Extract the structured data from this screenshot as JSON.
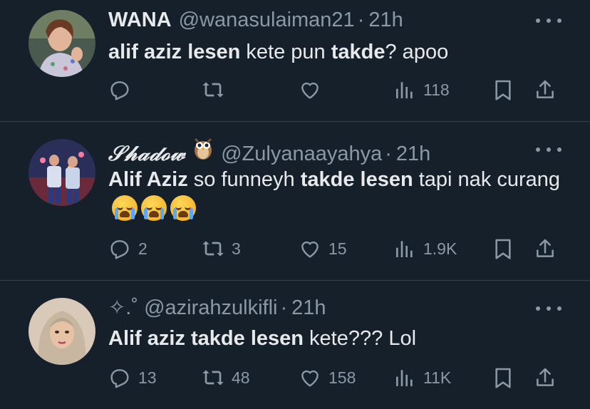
{
  "colors": {
    "background": "#15202b",
    "text_primary": "#e7e9ea",
    "text_secondary": "#8b98a5",
    "divider": "#38444d"
  },
  "tweets": [
    {
      "name": "WANA",
      "handle": "@wanasulaiman21",
      "dot": "·",
      "time": "21h",
      "text_parts": [
        {
          "t": "alif aziz lesen",
          "bold": true
        },
        {
          "t": " kete pun ",
          "bold": false
        },
        {
          "t": "takde",
          "bold": true
        },
        {
          "t": "? apoo",
          "bold": false
        }
      ],
      "replies": "",
      "retweets": "",
      "likes": "",
      "views": "118"
    },
    {
      "name": "𝒮𝒽𝒶𝒹ℴ𝓌",
      "name_emoji": "owl-emoji",
      "handle": "@Zulyanaayahya",
      "dot": "·",
      "time": "21h",
      "text_parts": [
        {
          "t": "Alif Aziz",
          "bold": true
        },
        {
          "t": " so funneyh ",
          "bold": false
        },
        {
          "t": "takde lesen",
          "bold": true
        },
        {
          "t": " tapi nak curang",
          "bold": false
        }
      ],
      "emojis": [
        "loudly-crying-face",
        "loudly-crying-face",
        "loudly-crying-face"
      ],
      "replies": "2",
      "retweets": "3",
      "likes": "15",
      "views": "1.9K"
    },
    {
      "name": "",
      "handle": "✧.˚ @azirahzulkifli",
      "dot": "·",
      "time": "21h",
      "text_parts": [
        {
          "t": "Alif aziz takde lesen",
          "bold": true
        },
        {
          "t": " kete??? Lol",
          "bold": false
        }
      ],
      "replies": "13",
      "retweets": "48",
      "likes": "158",
      "views": "11K"
    }
  ]
}
